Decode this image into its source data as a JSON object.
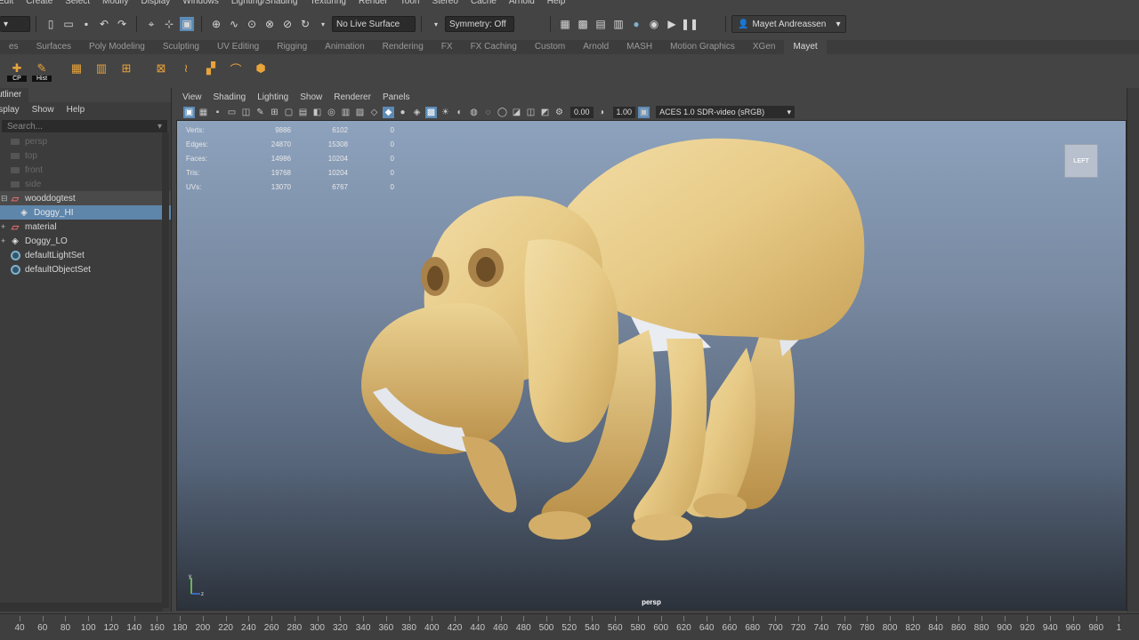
{
  "menubar": [
    "Edit",
    "Create",
    "Select",
    "Modify",
    "Display",
    "Windows",
    "Lighting/Shading",
    "Texturing",
    "Render",
    "Toon",
    "Stereo",
    "Cache",
    "Arnold",
    "Help"
  ],
  "statusline": {
    "live_surface": "No Live Surface",
    "symmetry": "Symmetry: Off",
    "user": "Mayet Andreassen"
  },
  "shelf_tabs": [
    "es",
    "Surfaces",
    "Poly Modeling",
    "Sculpting",
    "UV Editing",
    "Rigging",
    "Animation",
    "Rendering",
    "FX",
    "FX Caching",
    "Custom",
    "Arnold",
    "MASH",
    "Motion Graphics",
    "XGen",
    "Mayet"
  ],
  "shelf_tab_active": "Mayet",
  "shelf_icons": [
    {
      "name": "cp-icon",
      "label": "CP"
    },
    {
      "name": "hist-icon",
      "label": "Hist"
    },
    {
      "name": "freeze-icon",
      "label": ""
    },
    {
      "name": "grid-icon",
      "label": ""
    },
    {
      "name": "pivot-icon",
      "label": ""
    },
    {
      "name": "center-icon",
      "label": ""
    },
    {
      "name": "curves-icon",
      "label": ""
    },
    {
      "name": "uv-icon",
      "label": ""
    },
    {
      "name": "bridge-icon",
      "label": ""
    },
    {
      "name": "transfer-icon",
      "label": ""
    }
  ],
  "outliner": {
    "title": "utliner",
    "menu": [
      "isplay",
      "Show",
      "Help"
    ],
    "search_placeholder": "Search...",
    "items": [
      {
        "label": "persp",
        "type": "camera",
        "dim": true,
        "indent": 0
      },
      {
        "label": "top",
        "type": "camera",
        "dim": true,
        "indent": 0
      },
      {
        "label": "front",
        "type": "camera",
        "dim": true,
        "indent": 0
      },
      {
        "label": "side",
        "type": "camera",
        "dim": true,
        "indent": 0
      },
      {
        "label": "wooddogtest",
        "type": "group",
        "dim": false,
        "indent": 0,
        "state": "parent"
      },
      {
        "label": "Doggy_HI",
        "type": "mesh",
        "dim": false,
        "indent": 1,
        "state": "selected"
      },
      {
        "label": "material",
        "type": "group",
        "dim": false,
        "indent": 0
      },
      {
        "label": "Doggy_LO",
        "type": "mesh",
        "dim": false,
        "indent": 0
      },
      {
        "label": "defaultLightSet",
        "type": "set",
        "dim": false,
        "indent": 0
      },
      {
        "label": "defaultObjectSet",
        "type": "set",
        "dim": false,
        "indent": 0
      }
    ]
  },
  "viewport_menu": [
    "View",
    "Shading",
    "Lighting",
    "Show",
    "Renderer",
    "Panels"
  ],
  "viewport_toolbar": {
    "exposure": "0.00",
    "gamma": "1.00",
    "colorspace": "ACES 1.0 SDR-video (sRGB)"
  },
  "hud": [
    {
      "k": "Verts:",
      "v1": "9886",
      "v2": "6102",
      "v3": "0"
    },
    {
      "k": "Edges:",
      "v1": "24870",
      "v2": "15308",
      "v3": "0"
    },
    {
      "k": "Faces:",
      "v1": "14986",
      "v2": "10204",
      "v3": "0"
    },
    {
      "k": "Tris:",
      "v1": "19768",
      "v2": "10204",
      "v3": "0"
    },
    {
      "k": "UVs:",
      "v1": "13070",
      "v2": "6767",
      "v3": "0"
    }
  ],
  "viewcube_label": "LEFT",
  "camera_label": "persp",
  "timeline_ticks": [
    "40",
    "60",
    "80",
    "100",
    "120",
    "140",
    "160",
    "180",
    "200",
    "220",
    "240",
    "260",
    "280",
    "300",
    "320",
    "340",
    "360",
    "380",
    "400",
    "420",
    "440",
    "460",
    "480",
    "500",
    "520",
    "540",
    "560",
    "580",
    "600",
    "620",
    "640",
    "660",
    "680",
    "700",
    "720",
    "740",
    "760",
    "780",
    "800",
    "820",
    "840",
    "860",
    "880",
    "900",
    "920",
    "940",
    "960",
    "980",
    "1"
  ]
}
